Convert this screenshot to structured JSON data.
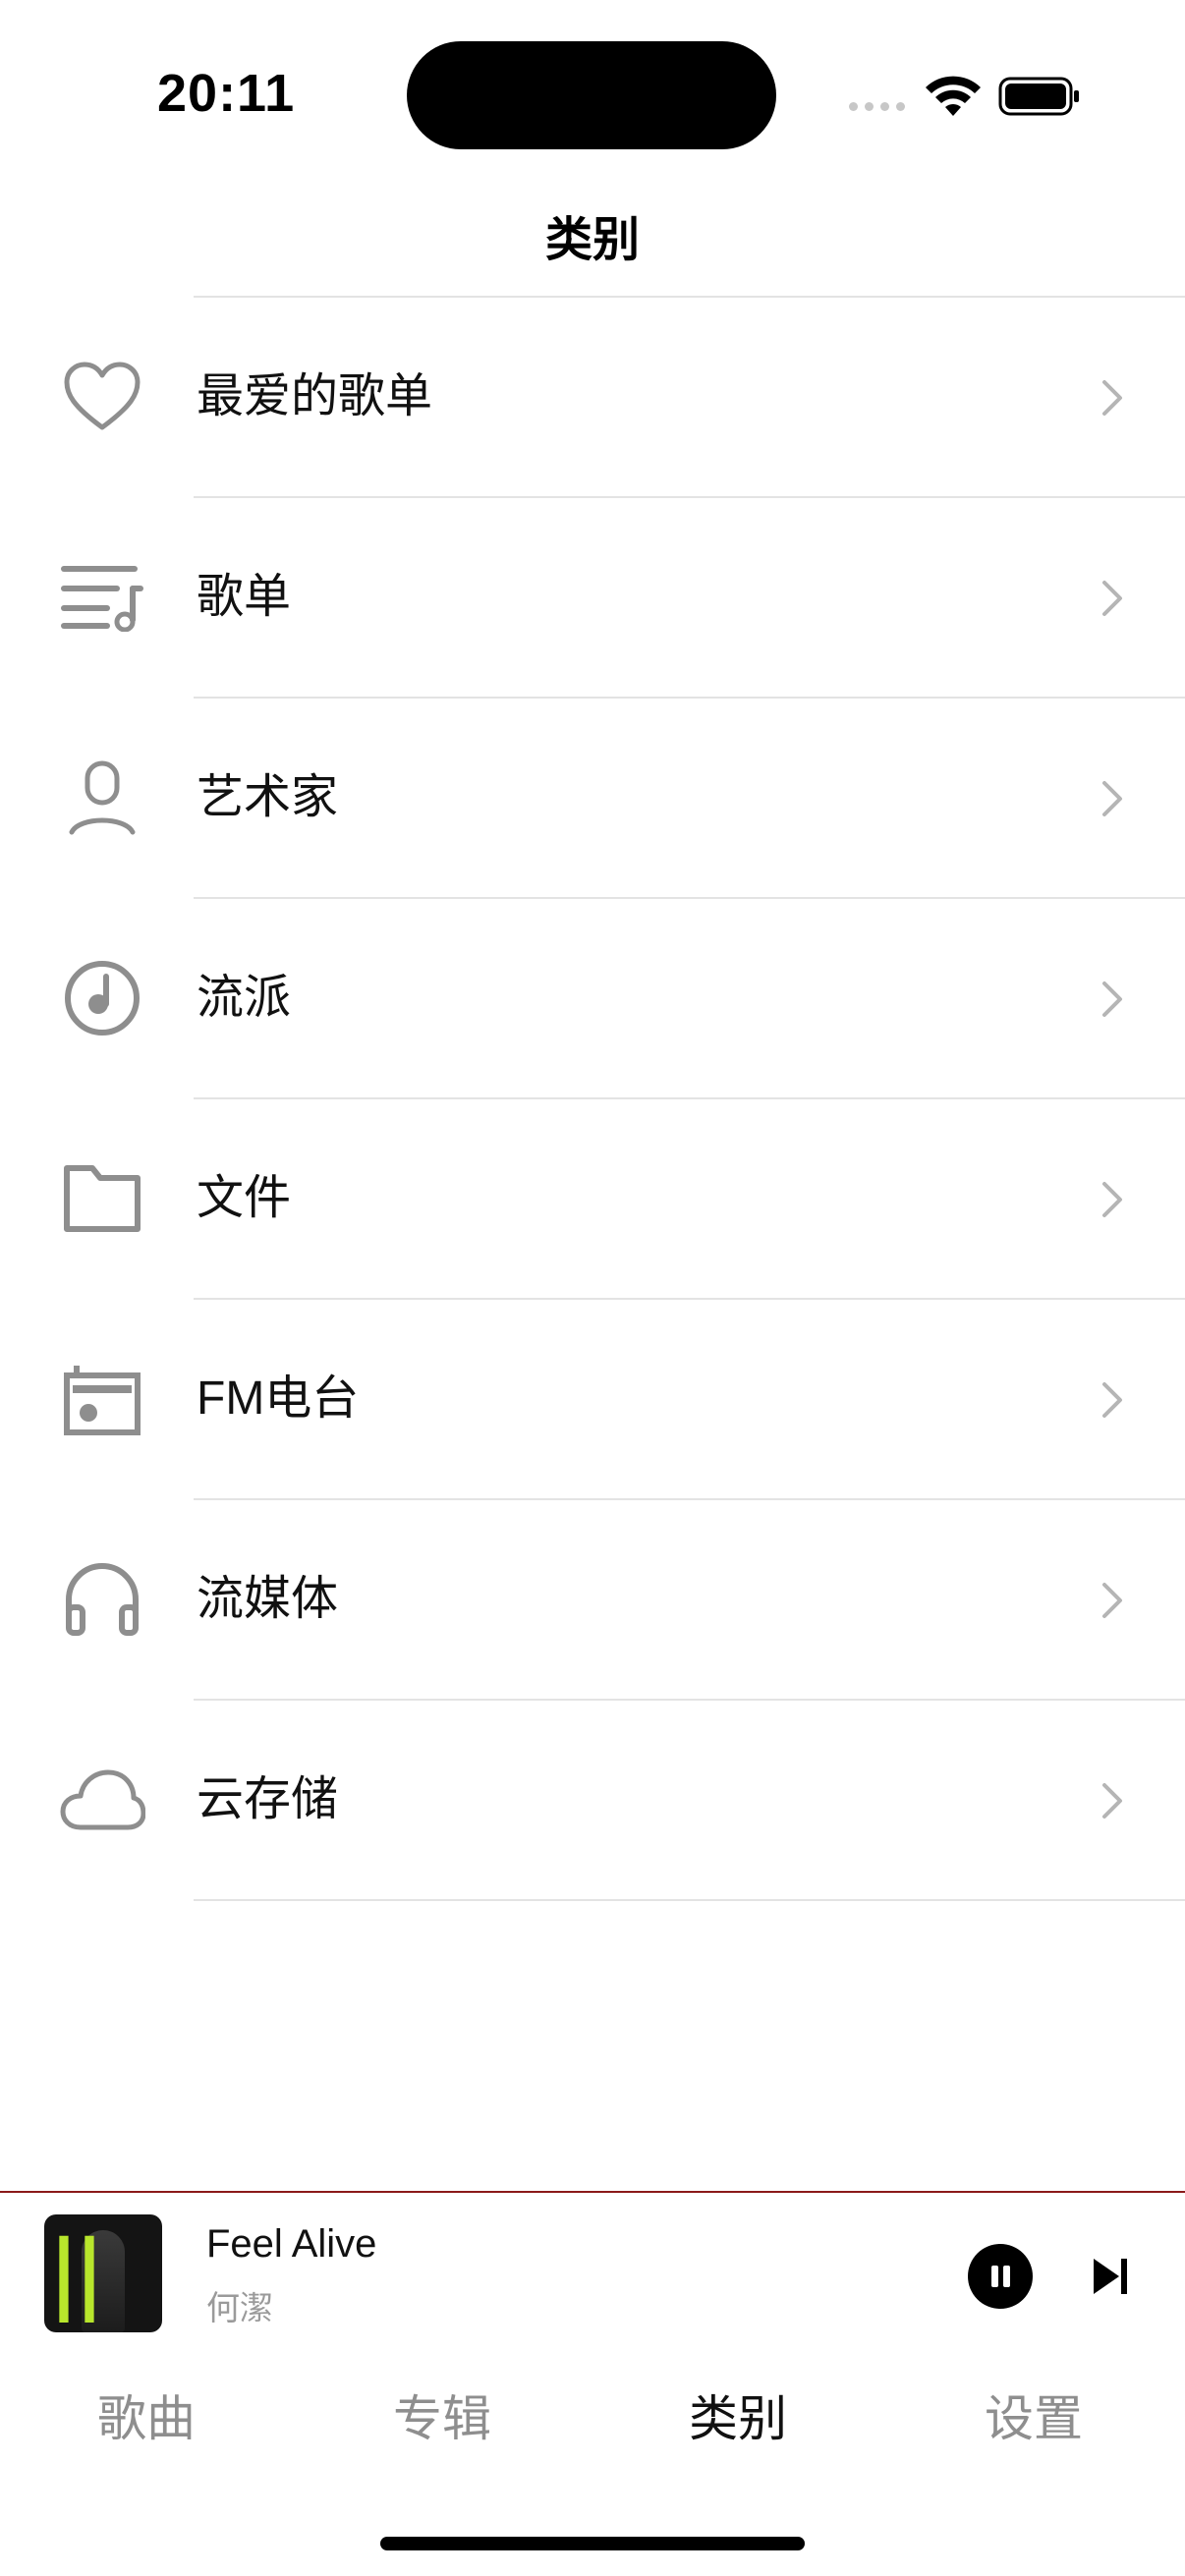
{
  "status_bar": {
    "time": "20:11"
  },
  "nav": {
    "title": "类别"
  },
  "categories": [
    {
      "label": "最爱的歌单",
      "icon": "heart-icon"
    },
    {
      "label": "歌单",
      "icon": "playlist-icon"
    },
    {
      "label": "艺术家",
      "icon": "person-icon"
    },
    {
      "label": "流派",
      "icon": "genre-icon"
    },
    {
      "label": "文件",
      "icon": "folder-icon"
    },
    {
      "label": "FM电台",
      "icon": "radio-icon"
    },
    {
      "label": "流媒体",
      "icon": "headphones-icon"
    },
    {
      "label": "云存储",
      "icon": "cloud-icon"
    }
  ],
  "now_playing": {
    "title": "Feel Alive",
    "artist": "何潔"
  },
  "tabs": [
    {
      "label": "歌曲"
    },
    {
      "label": "专辑"
    },
    {
      "label": "类别",
      "active": true
    },
    {
      "label": "设置"
    }
  ],
  "colors": {
    "icon_gray": "#8e8e8e",
    "divider": "#e3e3e3",
    "mini_player_border": "#8b1a1a"
  }
}
